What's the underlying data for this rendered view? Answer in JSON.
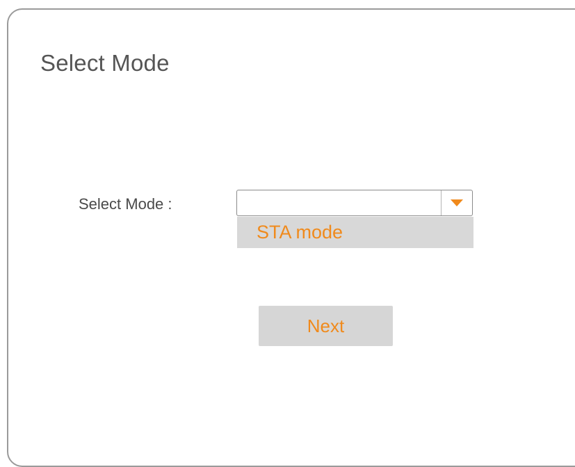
{
  "page": {
    "title": "Select Mode"
  },
  "form": {
    "mode_label": "Select Mode :",
    "mode_select": {
      "current_value": "",
      "options": [
        "STA mode"
      ]
    }
  },
  "actions": {
    "next_label": "Next"
  },
  "colors": {
    "accent": "#f08a1c",
    "option_background": "#d8d8d8",
    "button_background": "#d6d6d6",
    "panel_border": "#9a9a9a",
    "title_text": "#555555"
  },
  "icons": {
    "dropdown": "chevron-down-icon"
  }
}
